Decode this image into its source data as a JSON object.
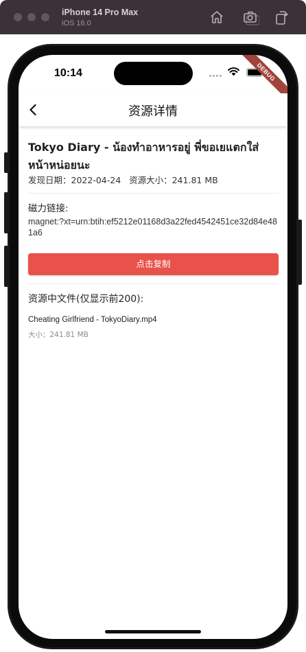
{
  "simulator": {
    "device_name": "iPhone 14 Pro Max",
    "os_version": "iOS 16.0",
    "buttons": [
      "home-icon",
      "screenshot-icon",
      "rotate-icon"
    ]
  },
  "status_bar": {
    "time": "10:14"
  },
  "debug_banner": "DEBUG",
  "app_bar": {
    "title": "资源详情",
    "back_icon": "chevron-left-icon"
  },
  "resource": {
    "title": "Tokyo Diary - น้องทำอาหารอยู่ พี่ขอเยแตกใส่หน้าหน่อยนะ",
    "found_date_label": "发现日期：",
    "found_date": "2022-04-24",
    "size_label": "资源大小：",
    "size": "241.81 MB"
  },
  "magnet": {
    "label": "磁力链接:",
    "link": "magnet:?xt=urn:btih:ef5212e01168d3a22fed4542451ce32d84e481a6",
    "copy_button_label": "点击复制"
  },
  "files": {
    "label": "资源中文件(仅显示前200):",
    "items": [
      {
        "name": "Cheating Girlfriend - TokyoDiary.mp4",
        "size_label": "大小：",
        "size": "241.81 MB"
      }
    ]
  },
  "colors": {
    "accent": "#e8524a",
    "debug_ribbon": "#a1443c",
    "simulator_bar": "#3a3236"
  }
}
